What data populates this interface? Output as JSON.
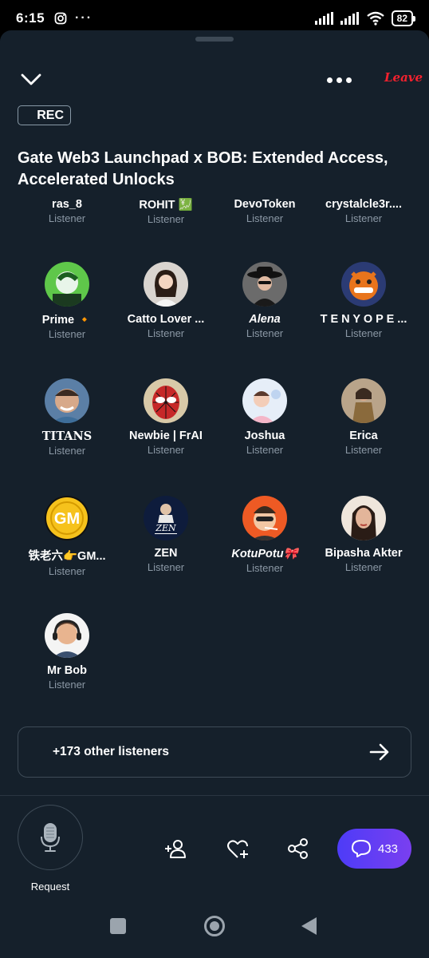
{
  "status_bar": {
    "time": "6:15",
    "battery": "82",
    "more": "···"
  },
  "header": {
    "leave_label": "Leave",
    "rec_label": "REC"
  },
  "space_title": "Gate Web3 Launchpad x BOB: Extended Access, Accelerated Unlocks",
  "listeners": [
    {
      "name": "ras_8",
      "role": "Listener"
    },
    {
      "name": "ROHIT 💹",
      "role": "Listener"
    },
    {
      "name": "DevoToken",
      "role": "Listener"
    },
    {
      "name": "crystalcle3r....",
      "role": "Listener"
    },
    {
      "name": "Prime 🔸",
      "role": "Listener"
    },
    {
      "name": "Catto Lover ...",
      "role": "Listener"
    },
    {
      "name": "Alena",
      "role": "Listener"
    },
    {
      "name": "T E N Y O P E ...",
      "role": "Listener"
    },
    {
      "name": "TITANS",
      "role": "Listener"
    },
    {
      "name": "Newbie | FrAI",
      "role": "Listener"
    },
    {
      "name": "Joshua",
      "role": "Listener"
    },
    {
      "name": "Erica",
      "role": "Listener"
    },
    {
      "name": "铁老六👉GM...",
      "role": "Listener"
    },
    {
      "name": "ZEN",
      "role": "Listener"
    },
    {
      "name": "KotuPotu🎀",
      "role": "Listener"
    },
    {
      "name": "Bipasha Akter",
      "role": "Listener"
    },
    {
      "name": "Mr Bob",
      "role": "Listener"
    }
  ],
  "avatar_text": {
    "gm": "GM",
    "zen": "ZEN"
  },
  "other_listeners": "+173 other listeners",
  "bottom_bar": {
    "request_label": "Request",
    "chat_count": "433"
  },
  "colors": {
    "background": "#15202b",
    "accent_chat": "#5a3df5",
    "leave": "#f4212e",
    "muted": "#8b98a5"
  }
}
